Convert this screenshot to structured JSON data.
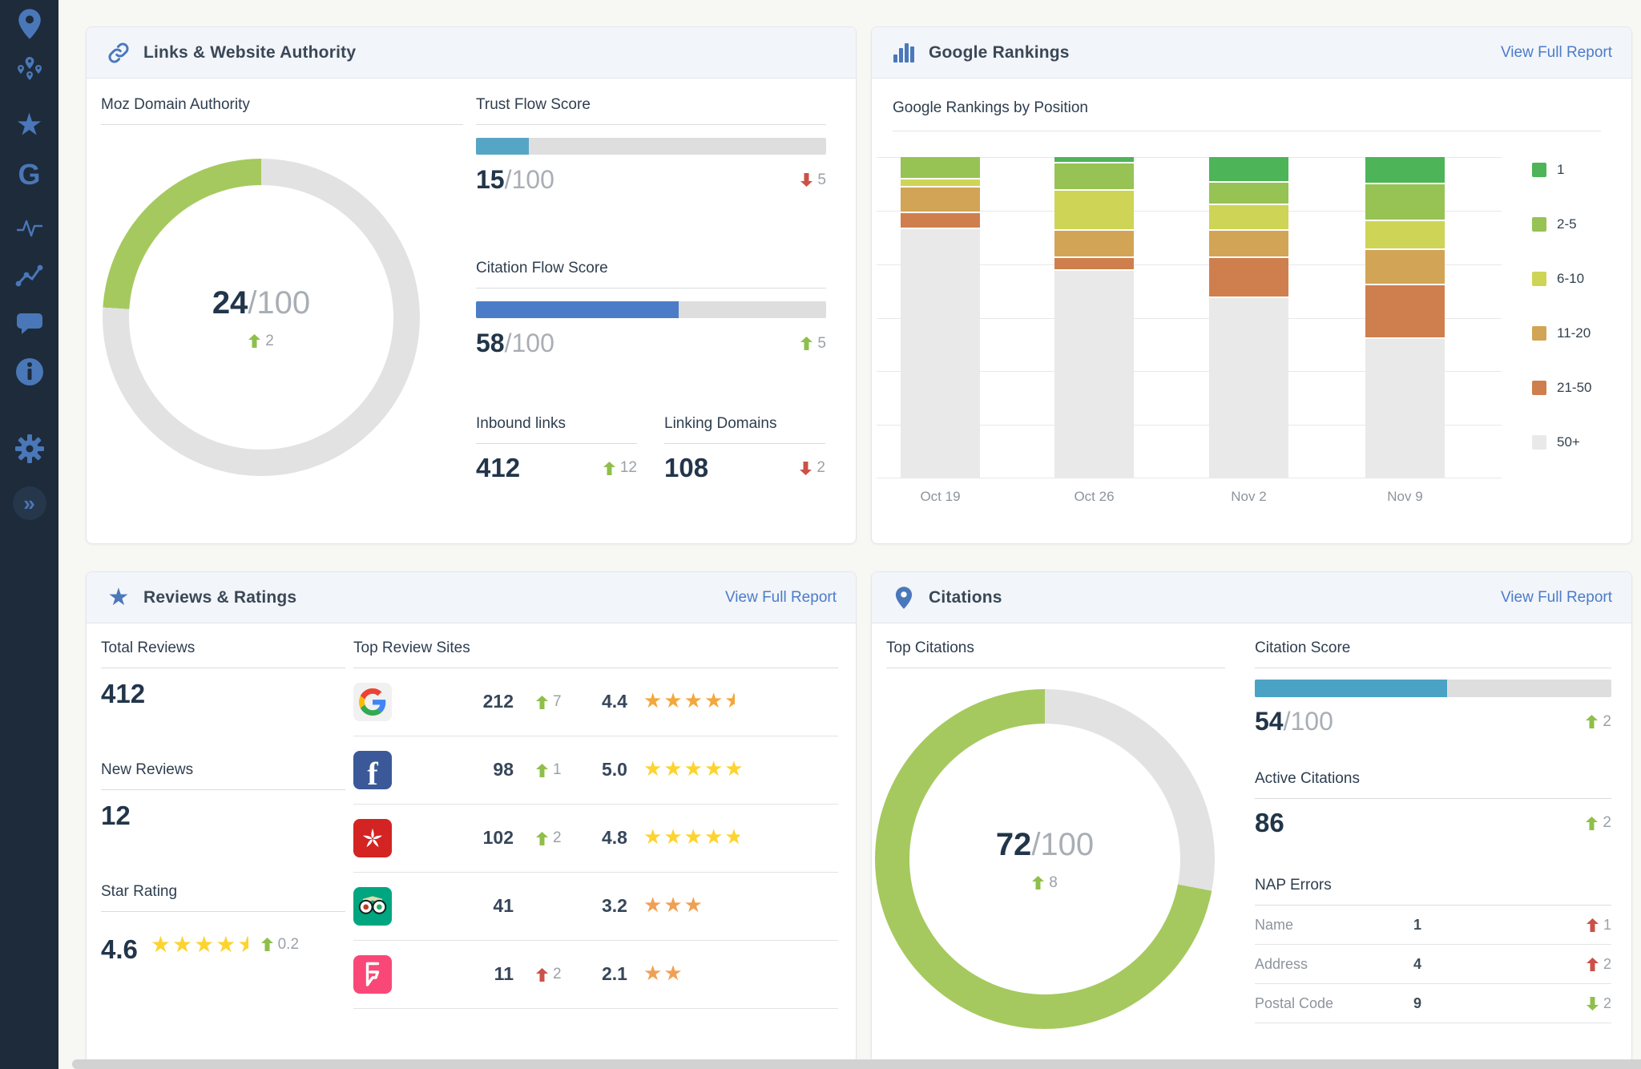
{
  "page": {
    "accent_blue": "#4b7cc9",
    "sidebar_bg": "#1d2b3b",
    "donut_green": "#a5c95e"
  },
  "sidebar": {
    "items": [
      {
        "icon": "location-pin"
      },
      {
        "icon": "map-pins-cluster"
      },
      {
        "icon": "star"
      },
      {
        "icon": "google-g"
      },
      {
        "icon": "pulse"
      },
      {
        "icon": "trend-line"
      },
      {
        "icon": "chat-bubble"
      },
      {
        "icon": "info"
      },
      {
        "icon": "gear"
      },
      {
        "icon": "collapse-chevrons"
      }
    ]
  },
  "panels": {
    "links": {
      "title": "Links & Website Authority",
      "moz": {
        "title": "Moz Domain Authority",
        "value": "24",
        "den": "/100",
        "pct": 24,
        "delta": "2",
        "delta_dir": "up"
      },
      "trust_flow": {
        "title": "Trust Flow Score",
        "value": "15",
        "den": "/100",
        "pct": 15,
        "delta": "5",
        "delta_dir": "down"
      },
      "citation_flow": {
        "title": "Citation Flow Score",
        "value": "58",
        "den": "/100",
        "pct": 58,
        "delta": "5",
        "delta_dir": "up"
      },
      "inbound": {
        "label": "Inbound links",
        "value": "412",
        "delta": "12",
        "delta_dir": "up"
      },
      "linking": {
        "label": "Linking Domains",
        "value": "108",
        "delta": "2",
        "delta_dir": "down"
      }
    },
    "rankings": {
      "title": "Google Rankings",
      "report_link": "View Full Report",
      "subtitle": "Google Rankings by Position"
    },
    "reviews": {
      "title": "Reviews & Ratings",
      "report_link": "View Full Report",
      "total": {
        "label": "Total Reviews",
        "value": "412"
      },
      "new": {
        "label": "New Reviews",
        "value": "12"
      },
      "star_rating": {
        "label": "Star Rating",
        "value": "4.6",
        "delta": "0.2",
        "delta_dir": "up",
        "stars": {
          "full": 4,
          "frac": 0.5,
          "color": "#fdd32f"
        }
      },
      "sites": {
        "label": "Top Review Sites",
        "rows": [
          {
            "site": "Google",
            "count": "212",
            "delta": "7",
            "delta_dir": "up",
            "delta_tone": "good",
            "rating": "4.4",
            "stars": {
              "full": 4,
              "frac": 0.5,
              "color": "#f3a73d"
            }
          },
          {
            "site": "Facebook",
            "count": "98",
            "delta": "1",
            "delta_dir": "up",
            "delta_tone": "good",
            "rating": "5.0",
            "stars": {
              "full": 5,
              "frac": 0,
              "color": "#fdd32f"
            }
          },
          {
            "site": "Yelp",
            "count": "102",
            "delta": "2",
            "delta_dir": "up",
            "delta_tone": "good",
            "rating": "4.8",
            "stars": {
              "full": 4,
              "frac": 0.75,
              "color": "#fdd32f"
            }
          },
          {
            "site": "TripAdvisor",
            "count": "41",
            "delta": "",
            "delta_dir": "none",
            "delta_tone": "none",
            "rating": "3.2",
            "stars": {
              "full": 3,
              "frac": 0,
              "color": "#f0a054"
            }
          },
          {
            "site": "Foursquare",
            "count": "11",
            "delta": "2",
            "delta_dir": "up",
            "delta_tone": "bad",
            "rating": "2.1",
            "stars": {
              "full": 2,
              "frac": 0,
              "color": "#f0a054"
            }
          }
        ]
      }
    },
    "citations": {
      "title": "Citations",
      "report_link": "View Full Report",
      "top": {
        "label": "Top Citations",
        "value": "72",
        "den": "/100",
        "pct": 72,
        "delta": "8",
        "delta_dir": "up"
      },
      "score": {
        "label": "Citation Score",
        "value": "54",
        "den": "/100",
        "pct": 54,
        "delta": "2",
        "delta_dir": "up"
      },
      "active": {
        "label": "Active Citations",
        "value": "86",
        "delta": "2",
        "delta_dir": "up"
      },
      "nap": {
        "label": "NAP Errors",
        "rows": [
          {
            "label": "Name",
            "value": "1",
            "delta": "1",
            "delta_dir": "up",
            "delta_tone": "bad"
          },
          {
            "label": "Address",
            "value": "4",
            "delta": "2",
            "delta_dir": "up",
            "delta_tone": "bad"
          },
          {
            "label": "Postal Code",
            "value": "9",
            "delta": "2",
            "delta_dir": "down",
            "delta_tone": "good"
          }
        ]
      }
    }
  },
  "chart_data": {
    "type": "bar",
    "variant": "stacked",
    "title": "Google Rankings by Position",
    "categories": [
      "Oct 19",
      "Oct 26",
      "Nov 2",
      "Nov 9"
    ],
    "value_unit": "percent of tracked keywords (estimated from bar heights; y-axis unlabeled)",
    "ylim": [
      0,
      100
    ],
    "grid": "horizontal",
    "legend_position": "right",
    "series": [
      {
        "name": "1",
        "color": "#4db458",
        "values": [
          0,
          2,
          8,
          8.5
        ]
      },
      {
        "name": "2-5",
        "color": "#96c353",
        "values": [
          7,
          8.5,
          7,
          11.5
        ]
      },
      {
        "name": "6-10",
        "color": "#ced456",
        "values": [
          2.5,
          12.5,
          8,
          9
        ]
      },
      {
        "name": "11-20",
        "color": "#d2a455",
        "values": [
          8,
          8.5,
          8.5,
          11
        ]
      },
      {
        "name": "21-50",
        "color": "#cf7f4e",
        "values": [
          5,
          4,
          12.5,
          16.5
        ]
      },
      {
        "name": "50+",
        "color": "#e9e9e9",
        "values": [
          77.5,
          64.5,
          56,
          43.5
        ]
      }
    ]
  }
}
